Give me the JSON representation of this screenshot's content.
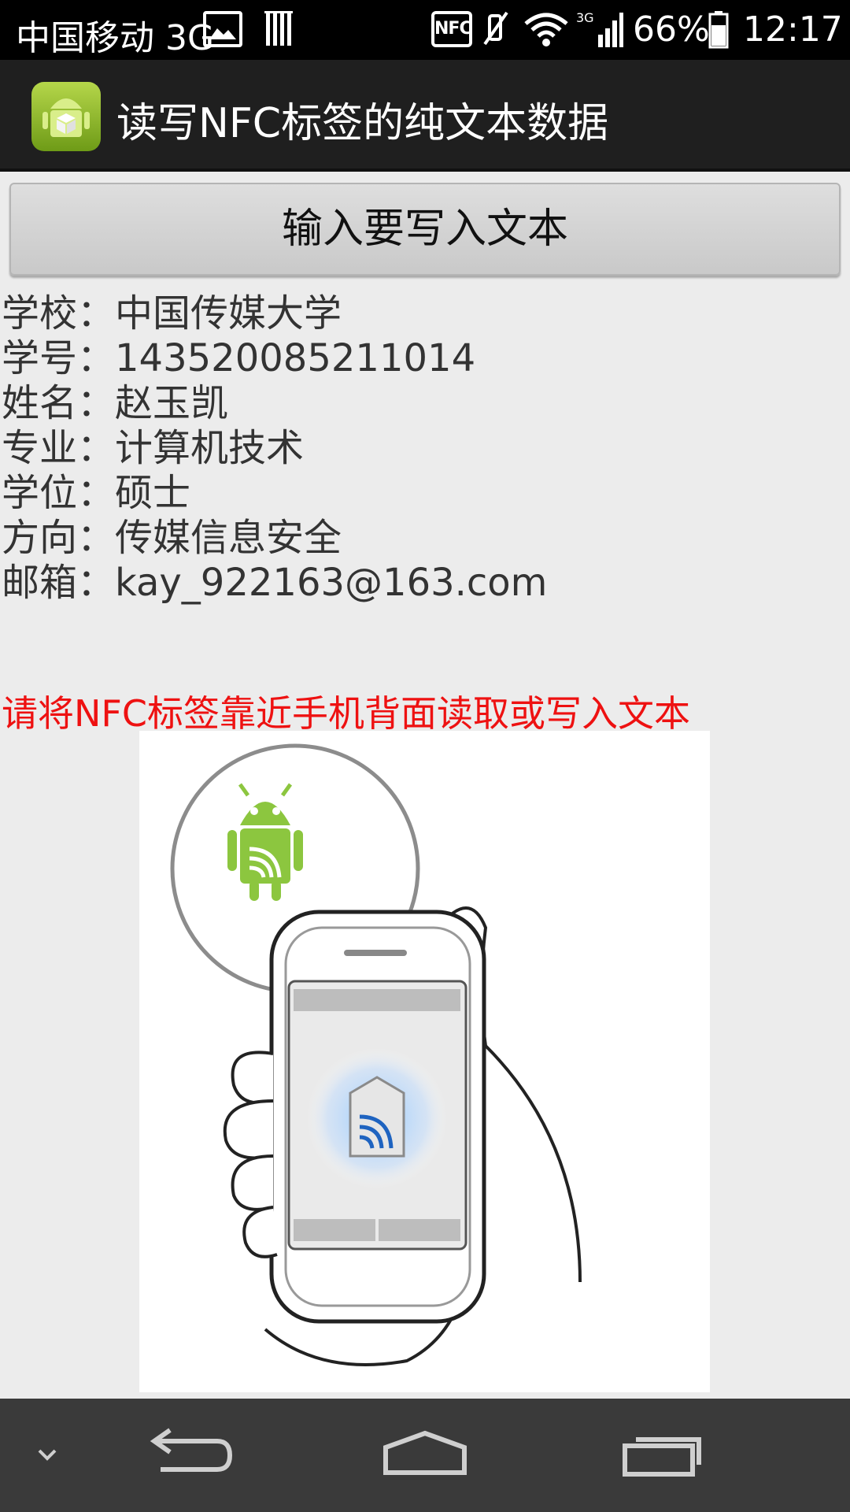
{
  "status_bar": {
    "carrier": "中国移动 3G",
    "nfc_label": "NFC",
    "signal_type": "3G",
    "battery": "66%",
    "time": "12:17",
    "icons": [
      "gallery-icon",
      "barcode-icon",
      "nfc-icon",
      "mute-icon",
      "wifi-icon",
      "signal-icon",
      "battery-icon"
    ]
  },
  "action_bar": {
    "title": "读写NFC标签的纯文本数据"
  },
  "write_button": {
    "label": "输入要写入文本"
  },
  "info": [
    {
      "label": "学校：",
      "value": "中国传媒大学"
    },
    {
      "label": "学号：",
      "value": "143520085211014"
    },
    {
      "label": "姓名：",
      "value": "赵玉凯"
    },
    {
      "label": "专业：",
      "value": "计算机技术"
    },
    {
      "label": "学位：",
      "value": "硕士"
    },
    {
      "label": "方向：",
      "value": "传媒信息安全"
    },
    {
      "label": "邮箱：",
      "value": "kay_922163@163.com"
    }
  ],
  "hint": "请将NFC标签靠近手机背面读取或写入文本",
  "colors": {
    "hint": "#ee1111",
    "android_green": "#8cc63f",
    "background": "#ececec"
  },
  "nav_bar": {
    "icons": [
      "hide-keyboard-icon",
      "back-icon",
      "home-icon",
      "recents-icon"
    ]
  }
}
